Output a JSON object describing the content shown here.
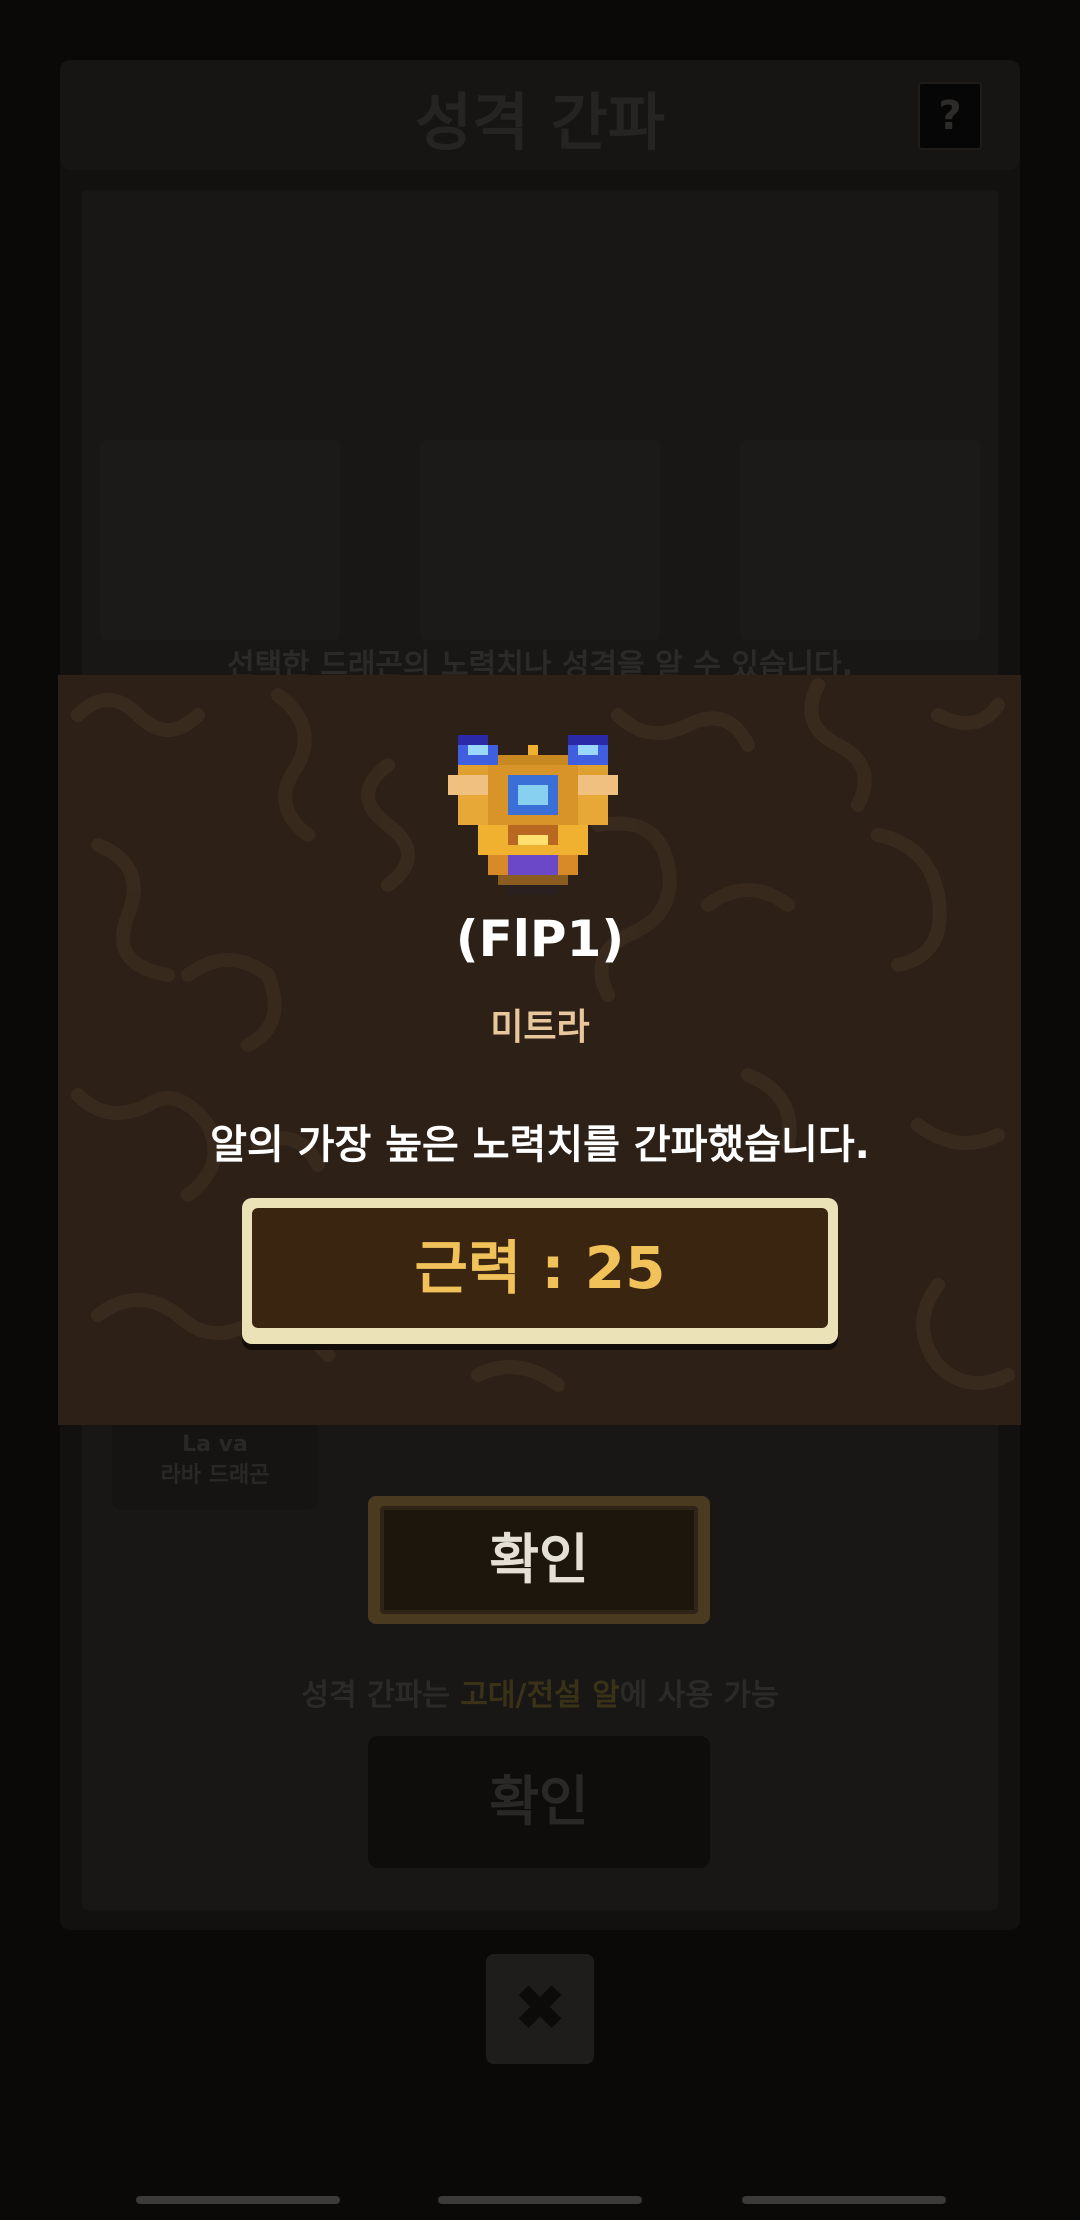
{
  "background": {
    "title": "성격 간파",
    "help_label": "?",
    "description": "선택한 드래곤의 노력치나 성격을 알 수 있습니다.",
    "lava_card": {
      "en": "La va",
      "ko": "라바 드래곤"
    },
    "confirm_label": "확인",
    "note_prefix": "성격 간파는 ",
    "note_highlight": "고대/전설 알",
    "note_suffix": "에 사용 가능",
    "confirm2_label": "확인",
    "close_label": "✖"
  },
  "modal": {
    "egg_code": "(FlP1)",
    "egg_name": "미트라",
    "result_message": "알의 가장 높은 노력치를 간파했습니다.",
    "stat_text": "근력 : 25"
  },
  "colors": {
    "modal_bg": "#2c2017",
    "stat_text": "#f2c25a",
    "name_text": "#e8c79c"
  }
}
